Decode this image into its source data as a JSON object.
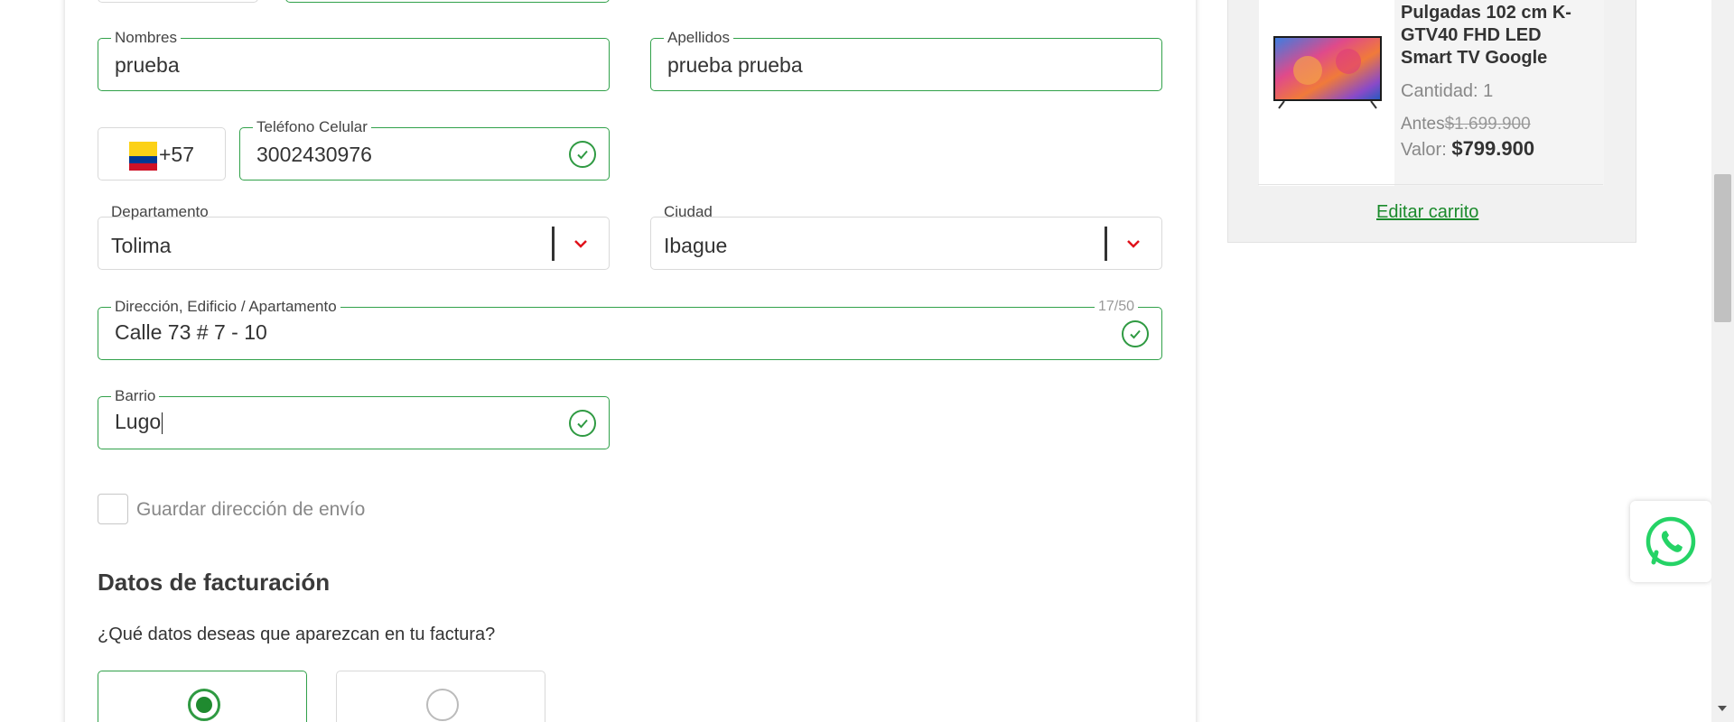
{
  "form": {
    "nombres": {
      "label": "Nombres",
      "value": "prueba"
    },
    "apellidos": {
      "label": "Apellidos",
      "value": "prueba prueba"
    },
    "phone": {
      "code": "+57",
      "label": "Teléfono Celular",
      "value": "3002430976"
    },
    "departamento": {
      "label": "Departamento",
      "value": "Tolima"
    },
    "ciudad": {
      "label": "Ciudad",
      "value": "Ibague"
    },
    "direccion": {
      "label": "Dirección, Edificio / Apartamento",
      "value": "Calle 73 # 7 - 10",
      "counter": "17/50"
    },
    "barrio": {
      "label": "Barrio",
      "value": "Lugo"
    },
    "save_address": {
      "label": "Guardar dirección de envío",
      "checked": false
    }
  },
  "billing": {
    "title": "Datos de facturación",
    "question": "¿Qué datos deseas que aparezcan en tu factura?",
    "options": [
      {
        "selected": true
      },
      {
        "selected": false
      }
    ]
  },
  "cart": {
    "product_name": "Pulgadas 102 cm K-GTV40 FHD LED Smart TV Google",
    "quantity": "Cantidad: 1",
    "old_price_label": "Antes",
    "old_price": "$1.699.900",
    "price_label": "Valor:",
    "price": "$799.900",
    "edit_link": "Editar carrito"
  },
  "colors": {
    "accent_green": "#31a14a",
    "chevron_red": "#e0121b",
    "whatsapp_green": "#25d366"
  },
  "icons": [
    "check-icon",
    "chevron-down-icon",
    "colombia-flag-icon",
    "whatsapp-icon"
  ]
}
